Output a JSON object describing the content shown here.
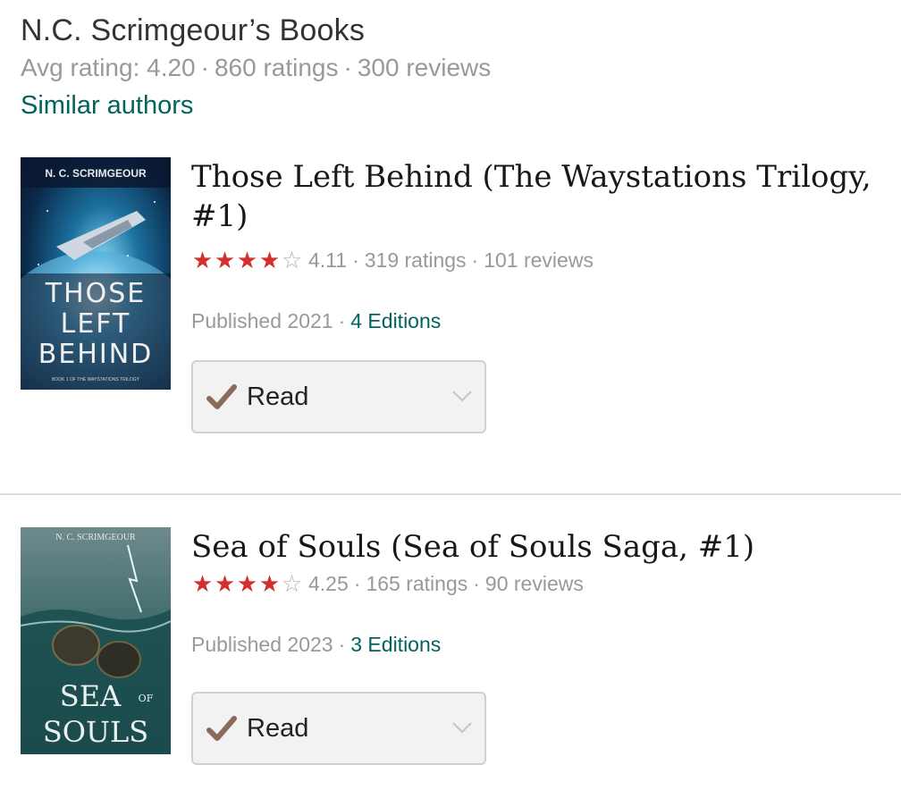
{
  "author": {
    "title": "N.C. Scrimgeour’s Books",
    "avg_rating": "Avg rating: 4.20",
    "ratings": "860 ratings",
    "reviews": "300 reviews",
    "similar_link": "Similar authors"
  },
  "separator": "·",
  "books": [
    {
      "title": "Those Left Behind (The Waystations Trilogy, #1)",
      "rating": 4.11,
      "rating_label": "4.11",
      "ratings": "319 ratings",
      "reviews": "101 reviews",
      "published": "Published 2021",
      "editions": "4 Editions",
      "shelf_status": "Read",
      "cover": {
        "author_line": "N. C. SCRIMGEOUR",
        "title_lines": [
          "THOSE",
          "LEFT",
          "BEHIND"
        ],
        "subtitle": "BOOK 1 OF THE WAYSTATIONS TRILOGY"
      }
    },
    {
      "title": "Sea of Souls (Sea of Souls Saga, #1)",
      "rating": 4.25,
      "rating_label": "4.25",
      "ratings": "165 ratings",
      "reviews": "90 reviews",
      "published": "Published 2023",
      "editions": "3 Editions",
      "shelf_status": "Read",
      "cover": {
        "author_line": "N. C. SCRIMGEOUR",
        "title_sea": "SEA",
        "title_of": "OF",
        "title_souls": "SOULS"
      }
    }
  ],
  "colors": {
    "star_red": "#d32f2f",
    "link_teal": "#00635d",
    "muted_gray": "#999999",
    "check_brown": "#8a6b5a"
  },
  "icons": {
    "star": "star-icon",
    "check": "checkmark-icon",
    "dropdown": "chevron-down-icon"
  }
}
